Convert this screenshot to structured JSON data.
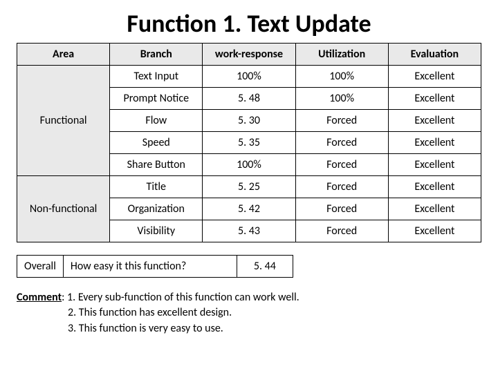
{
  "title": "Function 1. Text Update",
  "headers": [
    "Area",
    "Branch",
    "work-response",
    "Utilization",
    "Evaluation"
  ],
  "groups": [
    {
      "area": "Functional",
      "rows": [
        {
          "branch": "Text Input",
          "work": "100%",
          "util": "100%",
          "eval": "Excellent"
        },
        {
          "branch": "Prompt Notice",
          "work": "5. 48",
          "util": "100%",
          "eval": "Excellent"
        },
        {
          "branch": "Flow",
          "work": "5. 30",
          "util": "Forced",
          "eval": "Excellent"
        },
        {
          "branch": "Speed",
          "work": "5. 35",
          "util": "Forced",
          "eval": "Excellent"
        },
        {
          "branch": "Share Button",
          "work": "100%",
          "util": "Forced",
          "eval": "Excellent"
        }
      ]
    },
    {
      "area": "Non-functional",
      "rows": [
        {
          "branch": "Title",
          "work": "5. 25",
          "util": "Forced",
          "eval": "Excellent"
        },
        {
          "branch": "Organization",
          "work": "5. 42",
          "util": "Forced",
          "eval": "Excellent"
        },
        {
          "branch": "Visibility",
          "work": "5. 43",
          "util": "Forced",
          "eval": "Excellent"
        }
      ]
    }
  ],
  "summary": {
    "label": "Overall",
    "question": "How easy it this function?",
    "value": "5. 44"
  },
  "comment": {
    "label": "Comment",
    "lines": [
      "1. Every sub-function of this function can work well.",
      "2. This function has excellent design.",
      "3. This function is very easy to use."
    ]
  }
}
